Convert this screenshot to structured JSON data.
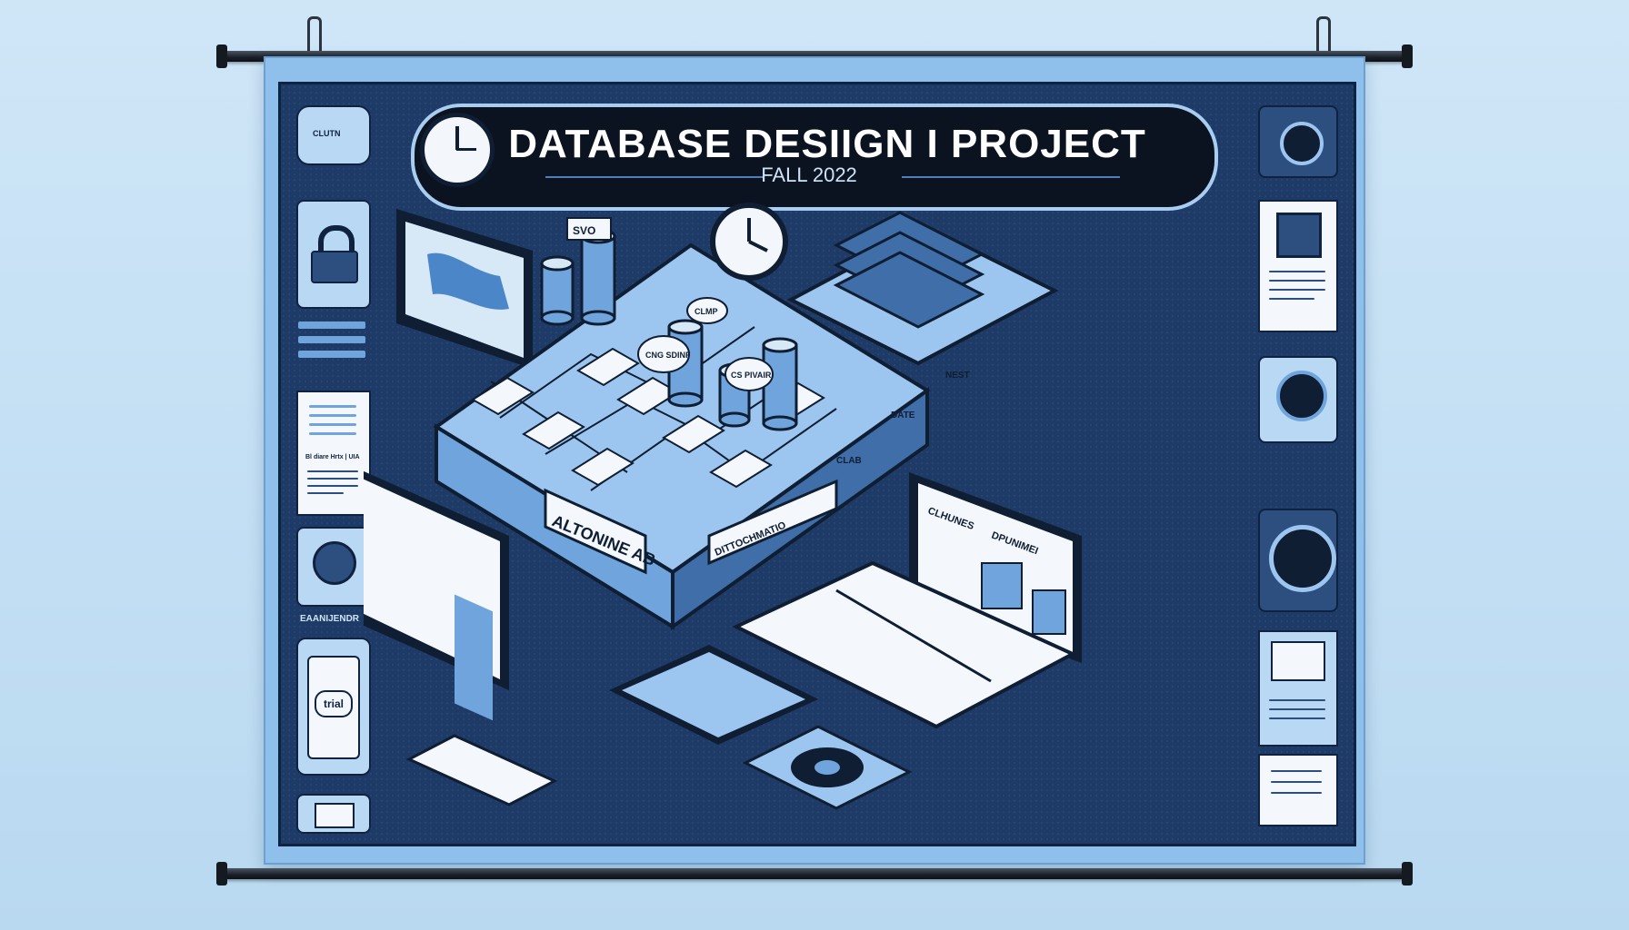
{
  "poster": {
    "title": "DATABASE   DESIIGN I PROJECT",
    "subtitle": "FALL 2022"
  },
  "labels": {
    "cloud_badge": "CLUTN",
    "server_label": "ALTONINE AB",
    "tag_svo": "SVO",
    "tag_cng": "CNG SDINF",
    "tag_clmp": "CLMP",
    "tag_cs": "CS PIVAIR",
    "tag_data": "DATE",
    "tag_clab": "CLAB",
    "tag_dbcont": "DITTOCHMATIO",
    "tag_nest": "NEST",
    "trial_tag": "trial",
    "exam_label": "EAANIJENDR",
    "left_card_text": "Bl diare Hrtx | UIA",
    "right_screen_a": "CLHUNES",
    "right_screen_b": "DPUNIMEI"
  },
  "colors": {
    "banner": "#8fc0ec",
    "panel": "#1e3a66",
    "accent": "#9cc6ef",
    "ink": "#0f1e33"
  },
  "icons": [
    "clock-icon",
    "lock-icon",
    "camera-icon",
    "envelope-icon",
    "database-icon",
    "book-stack-icon",
    "monitor-icon",
    "phone-icon",
    "keyboard-icon",
    "speaker-icon"
  ]
}
